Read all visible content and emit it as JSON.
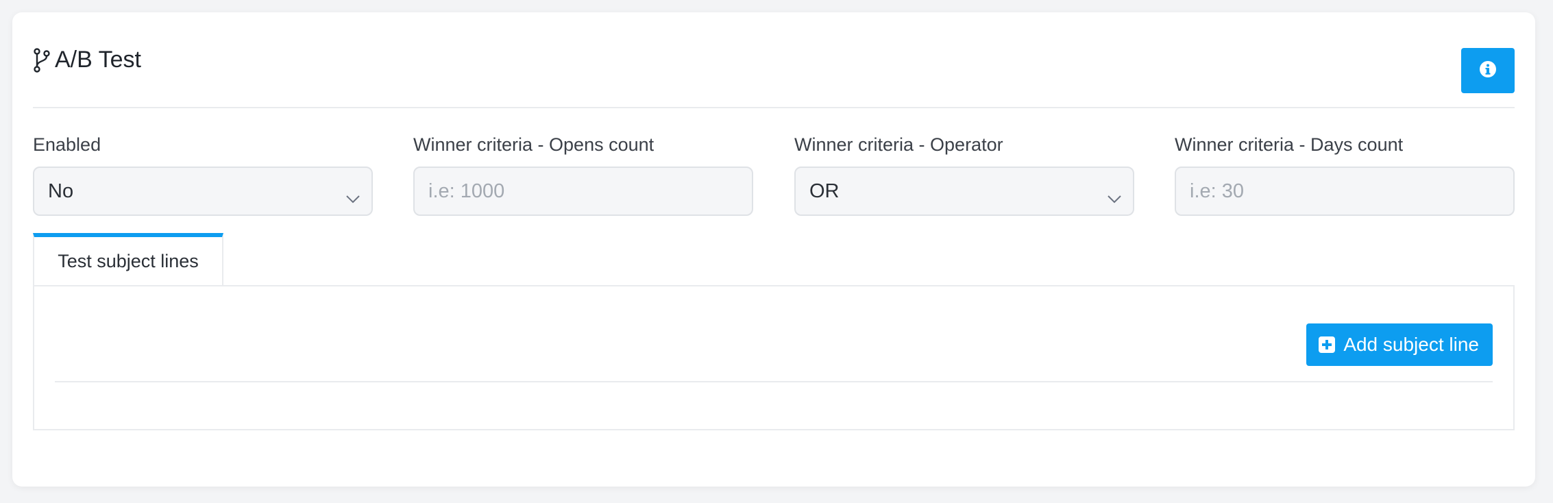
{
  "header": {
    "title": "A/B Test",
    "icon": "git-branch-icon",
    "info_icon": "info-circle-icon"
  },
  "fields": {
    "enabled": {
      "label": "Enabled",
      "value": "No"
    },
    "opens_count": {
      "label": "Winner criteria - Opens count",
      "placeholder": "i.e: 1000",
      "value": ""
    },
    "operator": {
      "label": "Winner criteria - Operator",
      "value": "OR"
    },
    "days_count": {
      "label": "Winner criteria - Days count",
      "placeholder": "i.e: 30",
      "value": ""
    }
  },
  "tabs": [
    {
      "label": "Test subject lines",
      "active": true
    }
  ],
  "panel": {
    "add_button_label": "Add subject line",
    "add_button_icon": "plus-square-icon"
  },
  "colors": {
    "accent": "#0d9df0",
    "background": "#f3f4f6",
    "card": "#ffffff"
  }
}
